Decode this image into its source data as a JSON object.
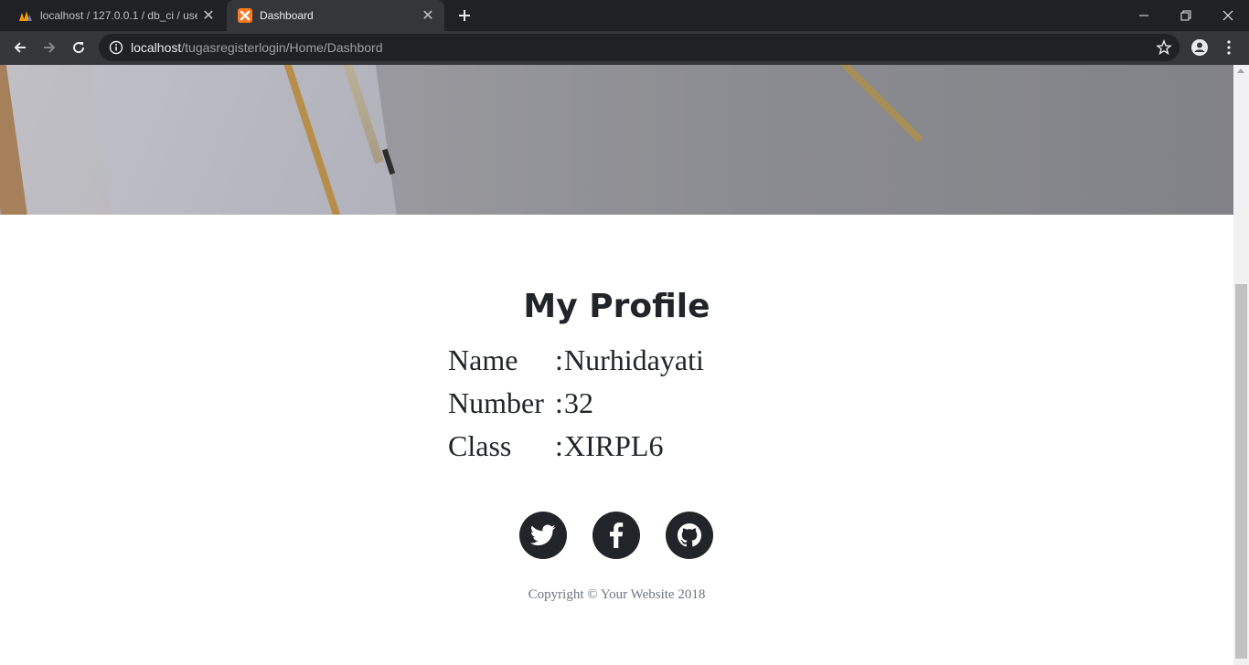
{
  "browser": {
    "tabs": [
      {
        "title": "localhost / 127.0.0.1 / db_ci / user",
        "icon": "phpmyadmin-icon",
        "active": false
      },
      {
        "title": "Dashboard",
        "icon": "xampp-icon",
        "active": true
      }
    ],
    "url_host": "localhost",
    "url_path": "/tugasregisterlogin/Home/Dashbord"
  },
  "page": {
    "profile_title": "My Profile",
    "rows": [
      {
        "label": "Name",
        "colon": ":",
        "value": "Nurhidayati"
      },
      {
        "label": "Number",
        "colon": ":",
        "value": "32"
      },
      {
        "label": "Class",
        "colon": ":",
        "value": "XIRPL6"
      }
    ],
    "social_icons": [
      "twitter-icon",
      "facebook-icon",
      "github-icon"
    ],
    "copyright": "Copyright © Your Website 2018"
  },
  "colors": {
    "chrome_dark": "#202124",
    "chrome_toolbar": "#35363a",
    "text_dark": "#212529",
    "muted": "#6c757d"
  }
}
